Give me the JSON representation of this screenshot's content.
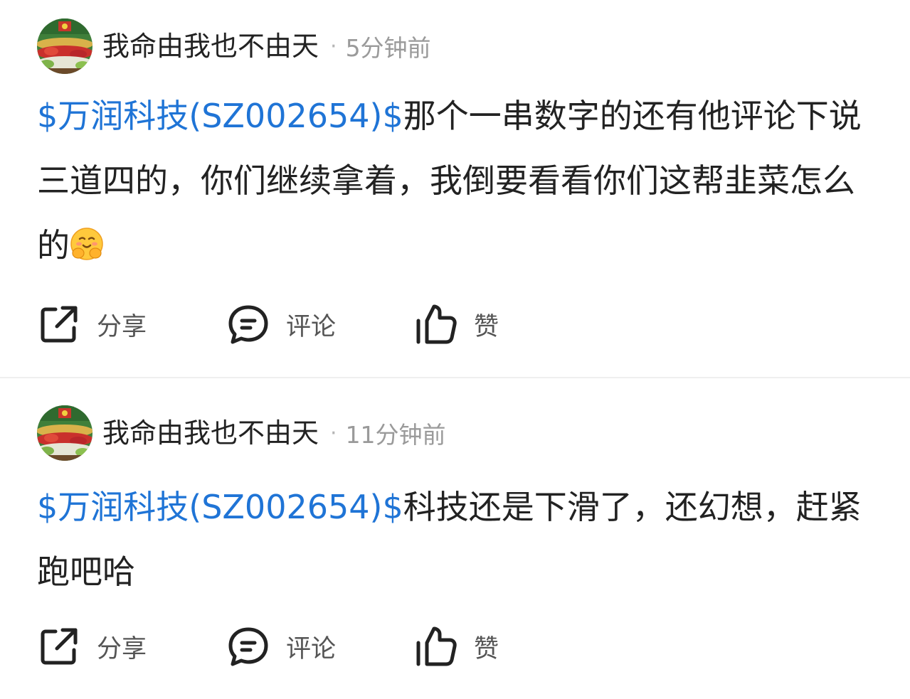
{
  "posts": [
    {
      "username": "我命由我也不由天",
      "separator": "·",
      "time": "5分钟前",
      "stock_tag": "$万润科技(SZ002654)$",
      "text": "那个一串数字的还有他评论下说三道四的，你们继续拿着，我倒要看看你们这帮韭菜怎么的",
      "emoji": "hugging-face-emoji",
      "actions": {
        "share": "分享",
        "comment": "评论",
        "like": "赞"
      }
    },
    {
      "username": "我命由我也不由天",
      "separator": "·",
      "time": "11分钟前",
      "stock_tag": "$万润科技(SZ002654)$",
      "text": "科技还是下滑了，还幻想，赶紧跑吧哈",
      "actions": {
        "share": "分享",
        "comment": "评论",
        "like": "赞"
      }
    }
  ],
  "colors": {
    "link": "#1f74d6",
    "text": "#222222",
    "muted": "#9a9a9a",
    "icon": "#222222",
    "divider": "#efefef"
  },
  "icons": {
    "share": "share-external-icon",
    "comment": "comment-bubble-icon",
    "like": "thumbs-up-icon"
  }
}
